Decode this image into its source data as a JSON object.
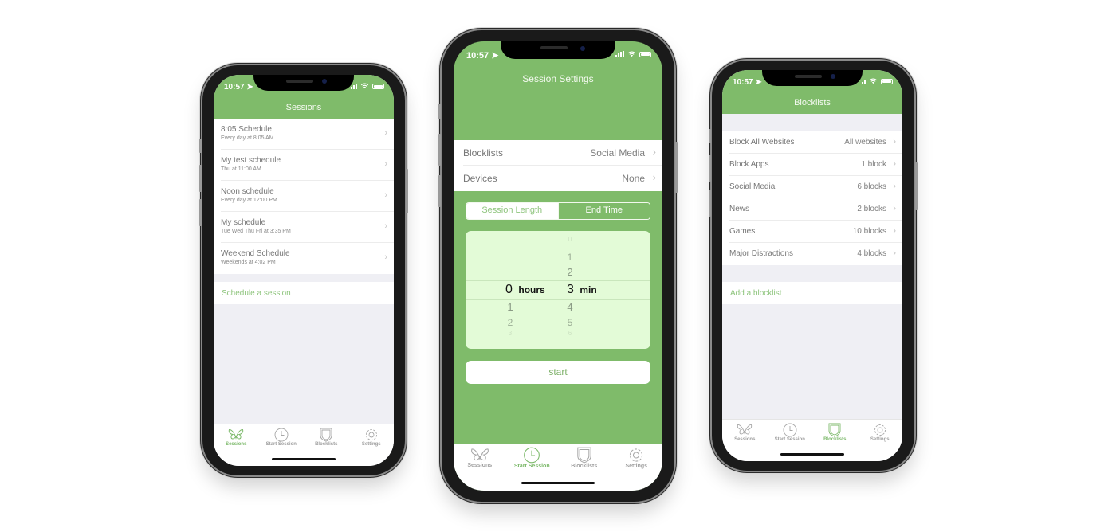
{
  "colors": {
    "brand_green": "#7fbb6a",
    "accent_green": "#8fc57e",
    "picker_bg": "#e3fbd7",
    "background": "#efeff4"
  },
  "status_bar": {
    "time": "10:57",
    "location_icon": "location-arrow-icon",
    "signal_icon": "signal-icon",
    "wifi_icon": "wifi-icon",
    "battery_icon": "battery-icon"
  },
  "tabs": [
    {
      "label": "Sessions",
      "icon": "butterfly-icon"
    },
    {
      "label": "Start Session",
      "icon": "clock-icon"
    },
    {
      "label": "Blocklists",
      "icon": "shield-icon"
    },
    {
      "label": "Settings",
      "icon": "gear-icon"
    }
  ],
  "sessions_screen": {
    "title": "Sessions",
    "active_tab": "Sessions",
    "items": [
      {
        "title": "8:05 Schedule",
        "subtitle": "Every day at 8:05 AM"
      },
      {
        "title": "My test schedule",
        "subtitle": "Thu at 11:00 AM"
      },
      {
        "title": "Noon schedule",
        "subtitle": "Every day at 12:00 PM"
      },
      {
        "title": "My schedule",
        "subtitle": "Tue Wed Thu Fri at 3:35 PM"
      },
      {
        "title": "Weekend Schedule",
        "subtitle": "Weekends at 4:02 PM"
      }
    ],
    "action_label": "Schedule a session"
  },
  "session_settings_screen": {
    "title": "Session Settings",
    "active_tab": "Start Session",
    "rows": [
      {
        "label": "Blocklists",
        "value": "Social Media"
      },
      {
        "label": "Devices",
        "value": "None"
      }
    ],
    "segments": [
      {
        "label": "Session Length",
        "selected": true
      },
      {
        "label": "End Time",
        "selected": false
      }
    ],
    "picker": {
      "hours": {
        "selected": "0",
        "unit": "hours",
        "below": [
          "1",
          "2",
          "3"
        ]
      },
      "minutes": {
        "selected": "3",
        "unit": "min",
        "above": [
          "0",
          "1",
          "2"
        ],
        "below": [
          "4",
          "5",
          "6"
        ]
      }
    },
    "start_label": "start"
  },
  "blocklists_screen": {
    "title": "Blocklists",
    "active_tab": "Blocklists",
    "items": [
      {
        "title": "Block All Websites",
        "value": "All websites"
      },
      {
        "title": "Block Apps",
        "value": "1 block"
      },
      {
        "title": "Social Media",
        "value": "6 blocks"
      },
      {
        "title": "News",
        "value": "2 blocks"
      },
      {
        "title": "Games",
        "value": "10 blocks"
      },
      {
        "title": "Major Distractions",
        "value": "4 blocks"
      }
    ],
    "action_label": "Add a blocklist"
  }
}
